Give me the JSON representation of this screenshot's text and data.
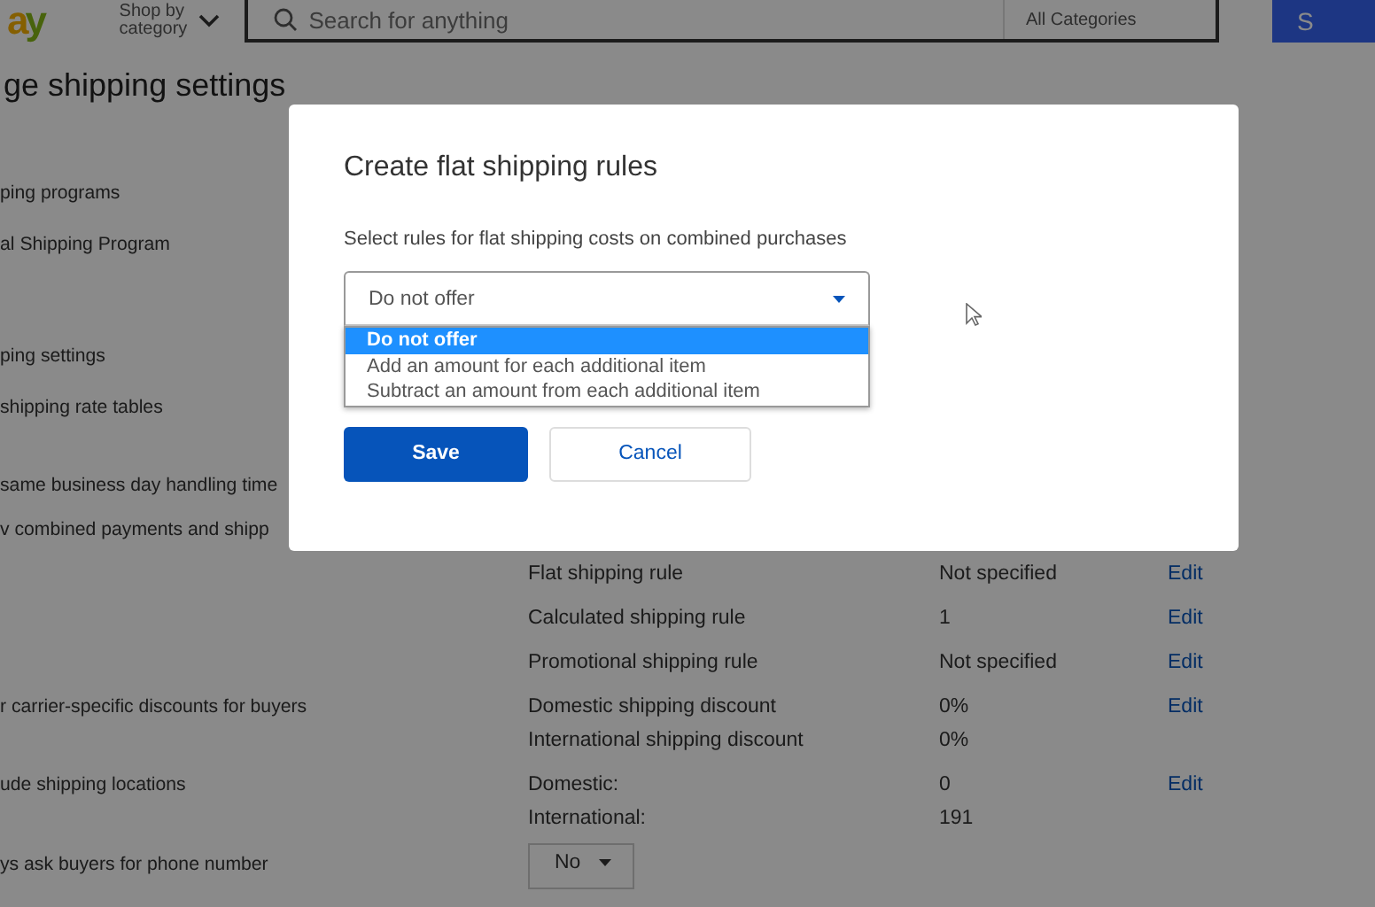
{
  "header": {
    "logo": "ay",
    "shop_by": "Shop by",
    "category": "category",
    "search": {
      "placeholder": "Search for anything"
    },
    "category_select": "All Categories",
    "search_button": "S"
  },
  "page_title": "ge shipping settings",
  "rows": [
    {
      "left": "ping programs"
    },
    {
      "left": "al Shipping Program"
    },
    {
      "left": "ping settings"
    },
    {
      "left": "shipping rate tables"
    },
    {
      "left": "same business day handling time"
    },
    {
      "left": "v combined payments and shipp"
    },
    {
      "label": "Flat shipping rule",
      "value": "Not specified",
      "action": "Edit"
    },
    {
      "label": "Calculated shipping rule",
      "value": "1",
      "action": "Edit"
    },
    {
      "label": "Promotional shipping rule",
      "value": "Not specified",
      "action": "Edit"
    },
    {
      "left": "r carrier-specific discounts for buyers",
      "label": "Domestic shipping discount",
      "value": "0%",
      "action": "Edit"
    },
    {
      "label": "International shipping discount",
      "value": "0%"
    },
    {
      "left": "ude shipping locations",
      "label": "Domestic:",
      "value": "0",
      "action": "Edit"
    },
    {
      "label": "International:",
      "value": "191"
    },
    {
      "left": "ys ask buyers for phone number",
      "dropdown": "No"
    }
  ],
  "dialog": {
    "title": "Create flat shipping rules",
    "description": "Select rules for flat shipping costs on combined purchases",
    "select": {
      "value": "Do not offer",
      "expanded": true,
      "options": [
        {
          "label": "Do not offer",
          "selected": true
        },
        {
          "label": "Add an amount for each additional item",
          "selected": false
        },
        {
          "label": "Subtract an amount from each additional item",
          "selected": false
        }
      ]
    },
    "buttons": [
      {
        "label": "Save",
        "kind": "primary"
      },
      {
        "label": "Cancel",
        "kind": "secondary"
      }
    ]
  }
}
